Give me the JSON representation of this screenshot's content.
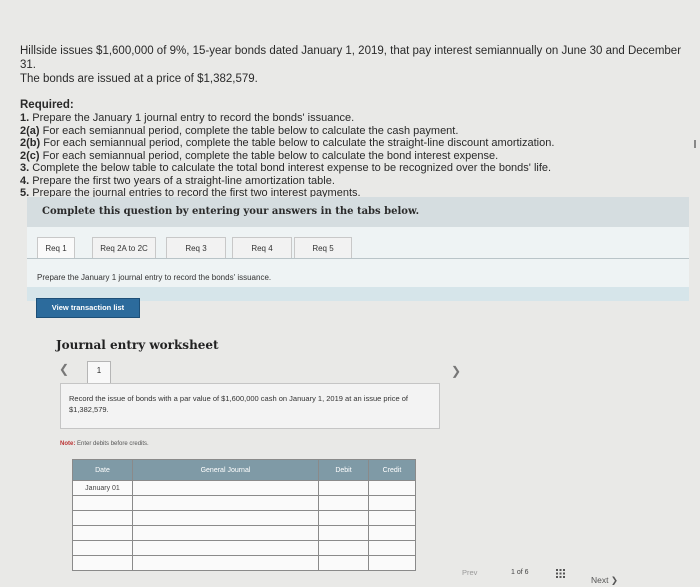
{
  "problem": {
    "line1": "Hillside issues $1,600,000 of 9%, 15-year bonds dated January 1, 2019, that pay interest semiannually on June 30 and December 31.",
    "line2": "The bonds are issued at a price of $1,382,579.",
    "required_label": "Required:",
    "requirements": [
      {
        "num": "1.",
        "text": " Prepare the January 1 journal entry to record the bonds' issuance."
      },
      {
        "num": "2(a)",
        "text": " For each semiannual period, complete the table below to calculate the cash payment."
      },
      {
        "num": "2(b)",
        "text": " For each semiannual period, complete the table below to calculate the straight-line discount amortization."
      },
      {
        "num": "2(c)",
        "text": " For each semiannual period, complete the table below to calculate the bond interest expense."
      },
      {
        "num": "3.",
        "text": " Complete the below table to calculate the total bond interest expense to be recognized over the bonds' life."
      },
      {
        "num": "4.",
        "text": " Prepare the first two years of a straight-line amortization table."
      },
      {
        "num": "5.",
        "text": " Prepare the journal entries to record the first two interest payments."
      }
    ]
  },
  "instruction": "Complete this question by entering your answers in the tabs below.",
  "tabs": [
    "Req 1",
    "Req 2A to 2C",
    "Req 3",
    "Req 4",
    "Req 5"
  ],
  "tab_instruction": "Prepare the January 1 journal entry to record the bonds' issuance.",
  "view_button": "View transaction list",
  "worksheet": {
    "title": "Journal entry worksheet",
    "page_tab": "1",
    "entry_text": "Record the issue of bonds with a par value of $1,600,000 cash on January 1, 2019 at an issue price of $1,382,579.",
    "note_label": "Note:",
    "note_text": " Enter debits before credits.",
    "columns": [
      "Date",
      "General Journal",
      "Debit",
      "Credit"
    ],
    "first_date": "January 01"
  },
  "pager": {
    "prev": "Prev",
    "current": "1",
    "of": "of",
    "total": "6",
    "next": "Next"
  }
}
